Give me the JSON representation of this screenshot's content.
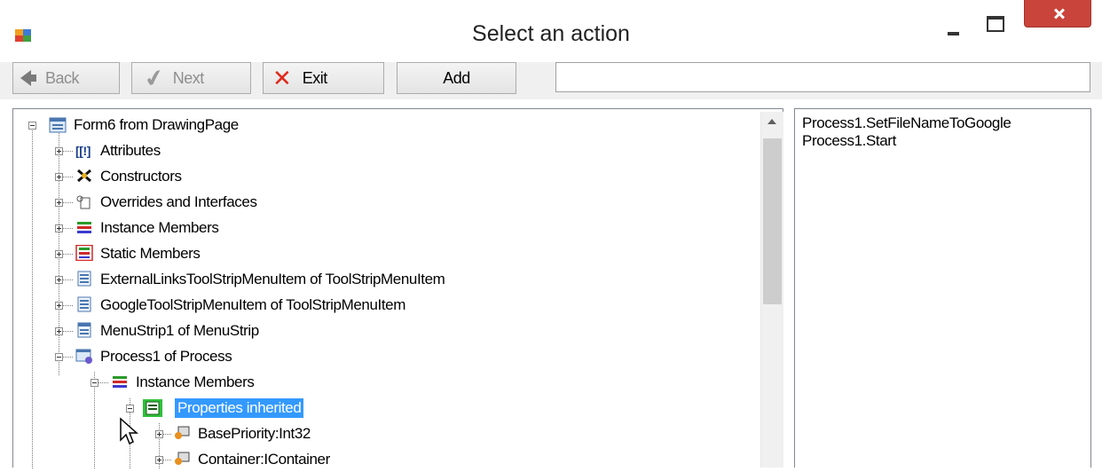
{
  "window": {
    "title": "Select an action",
    "accent_close": "#c9443a"
  },
  "toolbar": {
    "back_label": "Back",
    "next_label": "Next",
    "exit_label": "Exit",
    "add_label": "Add",
    "address_value": ""
  },
  "tree": {
    "root": "Form6 from DrawingPage",
    "items": [
      {
        "label": "Attributes",
        "icon": "attributes-icon"
      },
      {
        "label": "Constructors",
        "icon": "constructors-icon"
      },
      {
        "label": "Overrides and Interfaces",
        "icon": "interfaces-icon"
      },
      {
        "label": "Instance Members",
        "icon": "members-icon"
      },
      {
        "label": "Static Members",
        "icon": "static-members-icon"
      },
      {
        "label": "ExternalLinksToolStripMenuItem of ToolStripMenuItem",
        "icon": "menu-item-icon"
      },
      {
        "label": "GoogleToolStripMenuItem of ToolStripMenuItem",
        "icon": "menu-item-icon"
      },
      {
        "label": "MenuStrip1 of MenuStrip",
        "icon": "menu-strip-icon"
      },
      {
        "label": "Process1 of Process",
        "icon": "process-icon"
      }
    ],
    "process_children": {
      "instance_members": "Instance Members",
      "properties_inherited": "Properties inherited",
      "base_priority": "BasePriority:Int32",
      "container": "Container:IContainer"
    }
  },
  "actions": {
    "items": [
      "Process1.SetFileNameToGoogle",
      "Process1.Start"
    ]
  }
}
